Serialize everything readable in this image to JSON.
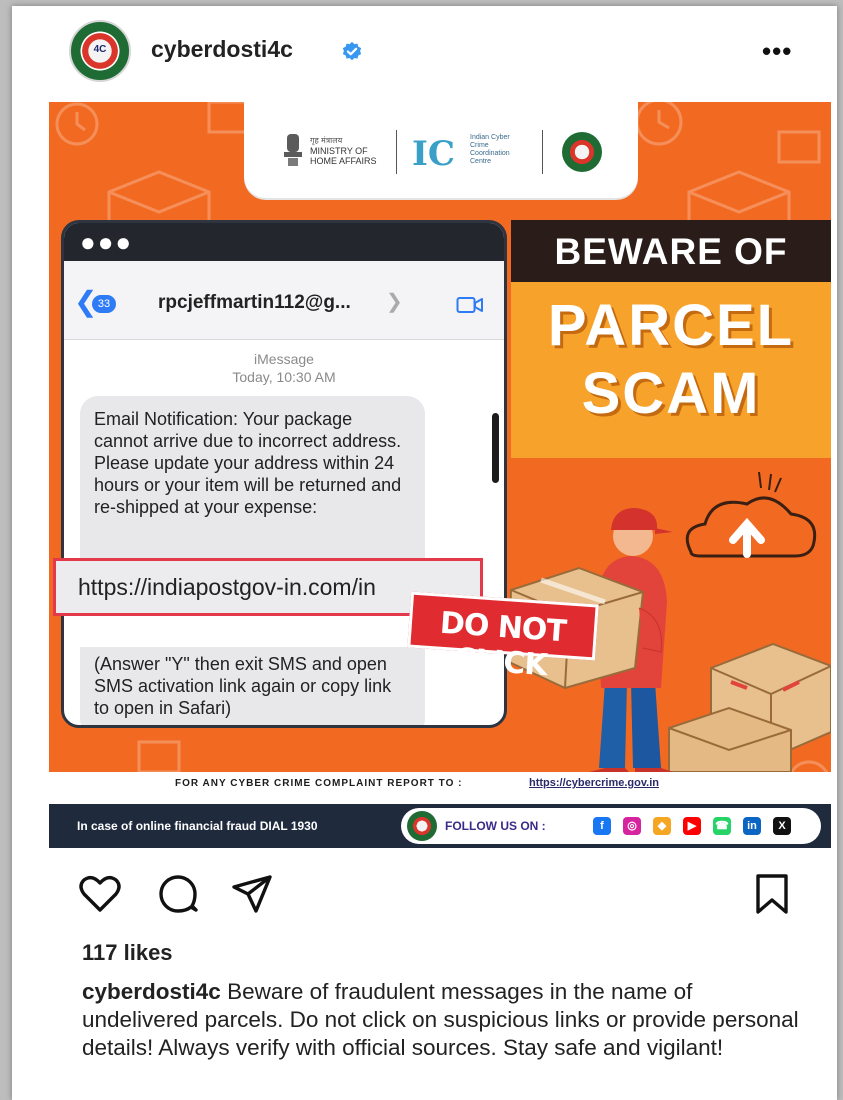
{
  "post": {
    "username": "cyberdosti4c",
    "more_label": "•••",
    "likes": "117 likes",
    "caption_user": "cyberdosti4c",
    "caption_text": " Beware of fraudulent messages in the name of undelivered parcels. Do not click on suspicious links or provide personal details! Always verify with official sources. Stay safe and vigilant!"
  },
  "poster": {
    "logo_strip": {
      "mha_hindi": "गृह मंत्रालय",
      "mha_line1": "MINISTRY OF",
      "mha_line2": "HOME AFFAIRS",
      "i4c_lines": "Indian Cyber Crime Coordination Centre"
    },
    "phone": {
      "unread_count": "33",
      "sender": "rpcjeffmartin112@g...",
      "service": "iMessage",
      "time": "Today, 10:30 AM",
      "message_part1": "Email Notification: Your package cannot arrive due to incorrect address. Please update your address within 24 hours or your item will be returned and re-shipped at your expense:",
      "link": "https://indiapostgov-in.com/in",
      "message_part2": "(Answer \"Y\" then exit SMS and open SMS activation link again or copy link to open in Safari)"
    },
    "headline": {
      "line1": "BEWARE OF",
      "line2": "PARCEL",
      "line3": "SCAM"
    },
    "stamp": "DO NOT CLICK",
    "footer": {
      "complaint_label": "FOR ANY CYBER CRIME COMPLAINT REPORT TO :",
      "complaint_url": "https://cybercrime.gov.in",
      "helpline": "In case of online financial fraud DIAL 1930",
      "follow_label": "FOLLOW US ON :"
    },
    "social_icons": [
      {
        "name": "facebook-icon",
        "glyph": "f",
        "color": "#1877f2"
      },
      {
        "name": "instagram-icon",
        "glyph": "◎",
        "color": "#d6249f"
      },
      {
        "name": "sharechat-icon",
        "glyph": "◆",
        "color": "#f5a623"
      },
      {
        "name": "youtube-icon",
        "glyph": "▶",
        "color": "#ff0000"
      },
      {
        "name": "whatsapp-icon",
        "glyph": "☎",
        "color": "#25d366"
      },
      {
        "name": "linkedin-icon",
        "glyph": "in",
        "color": "#0a66c2"
      },
      {
        "name": "x-icon",
        "glyph": "X",
        "color": "#111111"
      }
    ]
  },
  "colors": {
    "poster_orange": "#f26a22",
    "headline_gold": "#f7a22a",
    "alert_red": "#e02b30",
    "imessage_blue": "#2f7bf5"
  }
}
